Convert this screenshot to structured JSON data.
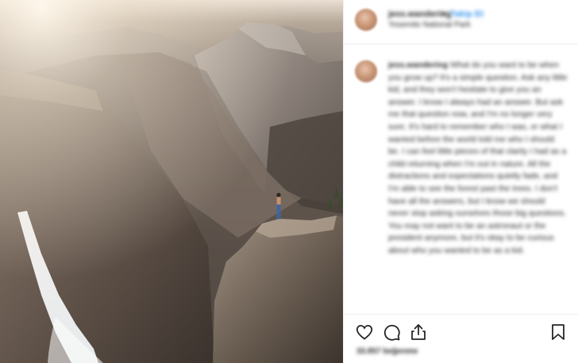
{
  "post": {
    "username": "jess.wandering",
    "separator": "•",
    "follow_label": "Takip Et",
    "location": "Yosemite National Park",
    "caption": "What do you want to be when you grow up? It's a simple question. Ask any little kid, and they won't hesitate to give you an answer. I know I always had an answer. But ask me that question now, and I'm no longer very sure. It's hard to remember who I was, or what I wanted before the world told me who I should be. I can feel little pieces of that clarity I had as a child returning when I'm out in nature. All the distractions and expectations quietly fade, and I'm able to see the forest past the trees. I don't have all the answers, but I know we should never stop asking ourselves those big questions. You may not want to be an astronaut or the president anymore, but it's okay to be curious about who you wanted to be as a kid.",
    "likes": "33.857 beğenme"
  },
  "icons": {
    "like": "heart-icon",
    "comment": "comment-icon",
    "share": "share-icon",
    "save": "bookmark-icon"
  },
  "colors": {
    "follow": "#3897f0",
    "text": "#262626",
    "divider": "#efefef"
  }
}
